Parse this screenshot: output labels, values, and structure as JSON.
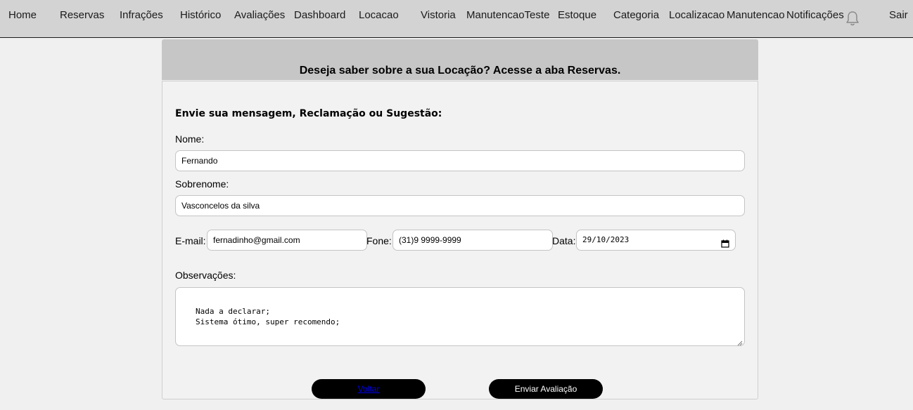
{
  "nav": {
    "items": [
      "Home",
      "Reservas",
      "Infrações",
      "Histórico",
      "Avaliações",
      "Dashboard",
      "Locacao",
      "Vistoria",
      "ManutencaoTeste",
      "Estoque",
      "Categoria",
      "Localizacao",
      "Manutencao",
      "Notificações"
    ],
    "logout": "Sair",
    "bell_icon": "bell-icon"
  },
  "banner": {
    "text": "Deseja saber sobre a sua Locação? Acesse a aba Reservas."
  },
  "form": {
    "title": "Envie sua mensagem, Reclamação ou Sugestão:",
    "nome_label": "Nome:",
    "nome_value": "Fernando",
    "sobrenome_label": "Sobrenome:",
    "sobrenome_value": "Vasconcelos da silva",
    "email_label": "E-mail:",
    "email_value": "fernadinho@gmail.com",
    "fone_label": "Fone:",
    "fone_value": "(31)9 9999-9999",
    "data_label": "Data:",
    "data_value": "29/10/2023",
    "obs_label": "Observações:",
    "obs_lines": [
      "Nada a declarar;",
      "Sistema ótimo, super recomendo;"
    ]
  },
  "buttons": {
    "back": "Voltar",
    "submit": "Enviar Avaliação"
  }
}
